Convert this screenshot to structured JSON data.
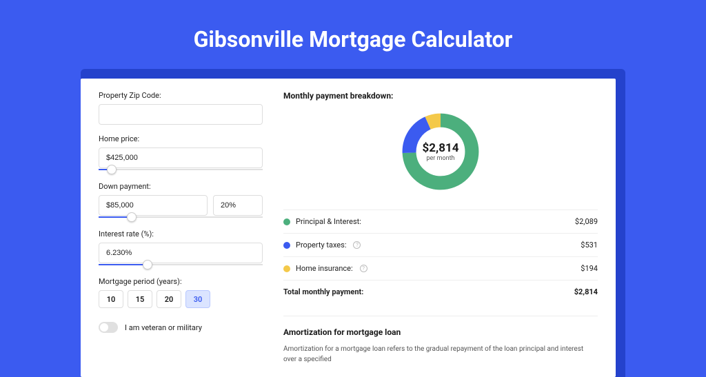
{
  "page_title": "Gibsonville Mortgage Calculator",
  "form": {
    "zip_label": "Property Zip Code:",
    "zip_value": "",
    "home_price_label": "Home price:",
    "home_price_value": "$425,000",
    "home_price_slider_pct": 8,
    "down_payment_label": "Down payment:",
    "down_payment_value": "$85,000",
    "down_payment_pct_value": "20%",
    "down_payment_slider_pct": 20,
    "interest_label": "Interest rate (%):",
    "interest_value": "6.230%",
    "interest_slider_pct": 30,
    "period_label": "Mortgage period (years):",
    "period_options": [
      "10",
      "15",
      "20",
      "30"
    ],
    "period_selected": "30",
    "veteran_label": "I am veteran or military"
  },
  "breakdown": {
    "title": "Monthly payment breakdown:",
    "donut_amount": "$2,814",
    "donut_sub": "per month",
    "items": [
      {
        "color": "green",
        "label": "Principal & Interest:",
        "value": "$2,089",
        "info": false
      },
      {
        "color": "blue",
        "label": "Property taxes:",
        "value": "$531",
        "info": true
      },
      {
        "color": "yellow",
        "label": "Home insurance:",
        "value": "$194",
        "info": true
      }
    ],
    "total_label": "Total monthly payment:",
    "total_value": "$2,814"
  },
  "amortization": {
    "title": "Amortization for mortgage loan",
    "text": "Amortization for a mortgage loan refers to the gradual repayment of the loan principal and interest over a specified"
  },
  "chart_data": {
    "type": "pie",
    "title": "Monthly payment breakdown",
    "series": [
      {
        "name": "Principal & Interest",
        "value": 2089,
        "color": "#4caf7d"
      },
      {
        "name": "Property taxes",
        "value": 531,
        "color": "#3b5bf0"
      },
      {
        "name": "Home insurance",
        "value": 194,
        "color": "#f4c94a"
      }
    ],
    "total": 2814,
    "center_label": "$2,814 per month"
  }
}
